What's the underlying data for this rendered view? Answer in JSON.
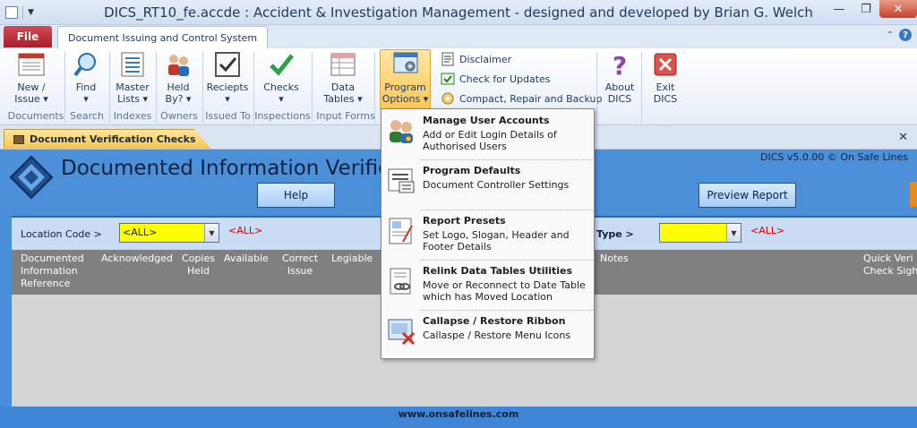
{
  "window": {
    "title": "DICS_RT10_fe.accde : Accident & Investigation Management - designed and developed by Brian G. Welch",
    "minimize": "—",
    "maximize": "❐",
    "close": "✕"
  },
  "tabs": {
    "file": "File",
    "active": "Document Issuing and Control System"
  },
  "ribbon": {
    "buttons": [
      {
        "label": "New /\nIssue ▾",
        "icon": "new-issue-icon"
      },
      {
        "label": "Find\n▾",
        "icon": "find-icon"
      },
      {
        "label": "Master\nLists ▾",
        "icon": "master-lists-icon"
      },
      {
        "label": "Held\nBy? ▾",
        "icon": "held-by-icon"
      },
      {
        "label": "Reciepts\n▾",
        "icon": "receipts-icon"
      },
      {
        "label": "Checks\n▾",
        "icon": "checks-icon"
      },
      {
        "label": "Data\nTables ▾",
        "icon": "data-tables-icon"
      },
      {
        "label": "Program\nOptions ▾",
        "icon": "program-options-icon"
      },
      {
        "label": "About\nDICS",
        "icon": "about-icon"
      },
      {
        "label": "Exit\nDICS",
        "icon": "exit-icon"
      }
    ],
    "groups": [
      "Documents",
      "Search",
      "Indexes",
      "Owners",
      "Issued To",
      "Inspections",
      "Input Forms"
    ],
    "small_items": [
      "Disclaimer",
      "Check for Updates",
      "Compact, Repair and Backup"
    ]
  },
  "doc_tab": {
    "label": "Document Verification Checks",
    "close": "✕"
  },
  "form": {
    "title": "Documented Information Verific",
    "version": "DICS v5.0.00 © On Safe Lines",
    "help_button": "Help",
    "preview_button": "Preview Report",
    "location_label": "Location Code >",
    "location_value": "<ALL>",
    "location_red": "<ALL>",
    "type_label": "Type >",
    "type_red": "<ALL>",
    "columns": [
      "Documented\nInformation\nReference",
      "Acknowledged",
      "Copies\nHeld",
      "Available",
      "Correct\nIssue",
      "Legiable",
      "Notes",
      "Quick Veri\nCheck Sigh"
    ],
    "footer_url": "www.onsafelines.com"
  },
  "menu": {
    "items": [
      {
        "title": "Manage User Accounts",
        "desc": "Add or Edit Login Details of Authorised Users",
        "icon": "users-key-icon"
      },
      {
        "title": "Program Defaults",
        "desc": "Document Controller Settings",
        "icon": "defaults-icon"
      },
      {
        "title": "Report Presets",
        "desc": "Set Logo, Slogan, Header and Footer Details",
        "icon": "report-presets-icon"
      },
      {
        "title": "Relink Data Tables Utilities",
        "desc": "Move or Reconnect to Date Table which has Moved Location",
        "icon": "relink-icon"
      },
      {
        "title": "Callapse / Restore Ribbon",
        "desc": "Callaspe / Restore Menu Icons",
        "icon": "collapse-ribbon-icon"
      }
    ]
  }
}
